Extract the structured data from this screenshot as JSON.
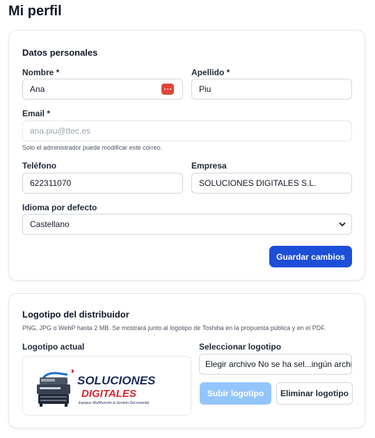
{
  "page": {
    "title": "Mi perfil"
  },
  "personal": {
    "section_title": "Datos personales",
    "nombre": {
      "label": "Nombre *",
      "value": "Ana"
    },
    "apellido": {
      "label": "Apellido *",
      "value": "Piu"
    },
    "email": {
      "label": "Email *",
      "value": "ana.piu@ttec.es",
      "hint": "Solo el administrador puede modificar este correo."
    },
    "telefono": {
      "label": "Teléfono",
      "value": "622311070"
    },
    "empresa": {
      "label": "Empresa",
      "value": "SOLUCIONES DIGITALES S.L."
    },
    "idioma": {
      "label": "Idioma por defecto",
      "value": "Castellano"
    },
    "save_label": "Guardar cambios",
    "password_manager_icon": "password-manager-icon"
  },
  "logo_section": {
    "section_title": "Logotipo del distribuidor",
    "description": "PNG, JPG o WebP hasta 2 MB. Se mostrará junto al logotipo de Toshiba en la propuesta pública y en el PDF.",
    "current_label": "Logotipo actual",
    "select_label": "Seleccionar logotipo",
    "file_input_text": "Elegir archivo No se ha sel...ingún archivo",
    "upload_label": "Subir logotipo",
    "delete_label": "Eliminar logotipo",
    "logo": {
      "line1": "SOLUCIONES",
      "line2": "DIGITALES",
      "tagline": "Equipos Multifunción & Gestión Documental",
      "icon": "printer-icon"
    }
  },
  "colors": {
    "primary": "#1d4ed8",
    "primary_disabled": "#93c5fd",
    "brand_red": "#d7262e",
    "brand_navy": "#1e2a5a"
  }
}
